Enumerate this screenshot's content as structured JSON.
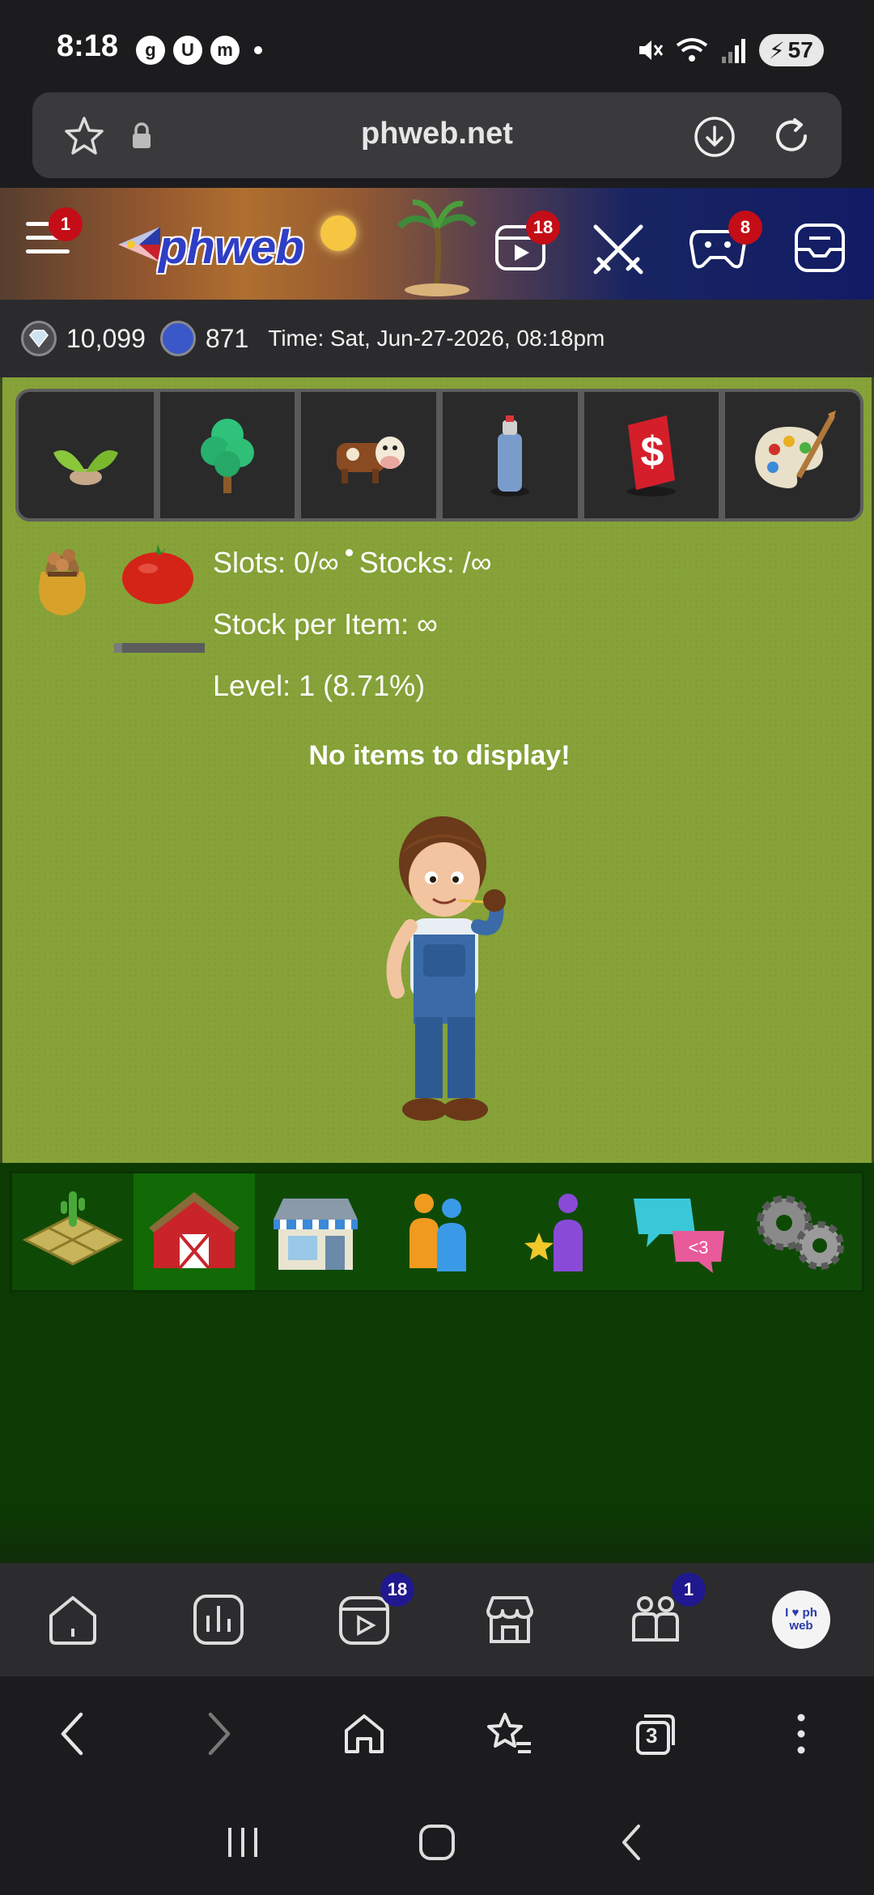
{
  "status_bar": {
    "time": "8:18",
    "left_icons": [
      "g",
      "U",
      "m"
    ],
    "battery": "57"
  },
  "url_bar": {
    "url": "phweb.net"
  },
  "site_header": {
    "logo": "phweb",
    "menu_badge": "1",
    "videos_badge": "18",
    "chat_badge": "8"
  },
  "currency": {
    "gems": "10,099",
    "medals": "871",
    "time": "Time: Sat, Jun-27-2026, 08:18pm"
  },
  "game_tabs": [
    "seeds-icon",
    "tree-icon",
    "cow-icon",
    "spray-can-icon",
    "dollar-sign-icon",
    "paint-palette-icon"
  ],
  "farm_info": {
    "slots": "Slots: 0/∞",
    "stocks": "Stocks: /∞",
    "stock_per_item": "Stock per Item: ∞",
    "level": "Level: 1 (8.71%)",
    "empty_message": "No items to display!",
    "progress": 0.0871
  },
  "game_nav": [
    "farm-plot-icon",
    "barn-icon",
    "shop-icon",
    "friends-icon",
    "favorites-icon",
    "chat-icon",
    "settings-gears-icon"
  ],
  "site_nav": {
    "videos_badge": "18",
    "groups_badge": "1",
    "profile_text": "I ♥ ph web"
  },
  "browser_bar": {
    "tabs_count": "3"
  },
  "colors": {
    "accent_red": "#c40d17",
    "badge_blue": "#20188e",
    "grass": "#86a238",
    "game_nav_bg": "#0e4a06"
  }
}
